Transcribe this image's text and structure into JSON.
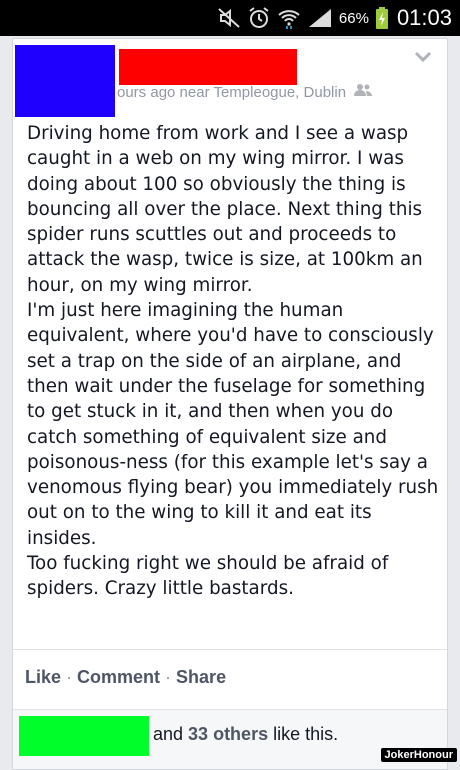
{
  "status_bar": {
    "icons": [
      "mute-icon",
      "alarm-icon",
      "wifi-icon",
      "signal-icon",
      "battery-charging-icon"
    ],
    "battery_percent": "66%",
    "time": "01:03"
  },
  "post": {
    "meta_text": "ours ago near Templeogue, Dublin",
    "privacy_icon": "friends-icon",
    "paragraphs": [
      "Driving home from work and I see a wasp caught in a web on my wing mirror. I was doing about 100 so obviously the thing is bouncing all over the place. Next thing this spider runs scuttles out and proceeds to attack the wasp, twice is size, at 100km an hour, on my wing mirror.",
      "I'm just here imagining the human equivalent, where you'd have to consciously set a trap on the side of an airplane, and then wait under the fuselage for something to get stuck in it, and then when you do catch something of equivalent size and poisonous-ness (for this example let's say a venomous flying bear) you immediately rush out on to the wing to kill it and eat its insides.",
      "Too fucking right we should be afraid of spiders. Crazy little bastards."
    ]
  },
  "actions": {
    "like": "Like",
    "comment": "Comment",
    "share": "Share",
    "separator": "·"
  },
  "likes": {
    "text_before": "and ",
    "count_text": "33 others",
    "text_after": " like this."
  },
  "watermark": "JokerHonour",
  "colors": {
    "avatar_redaction": "#1f00ff",
    "name_redaction": "#ff0000",
    "liker_redaction": "#00ff2a"
  }
}
